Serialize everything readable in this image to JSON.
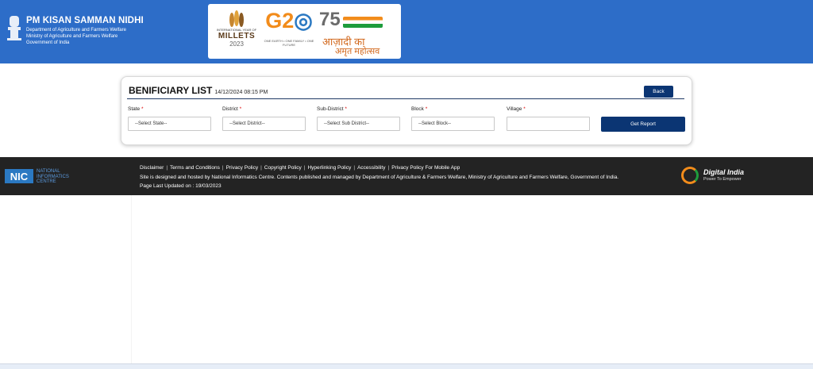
{
  "header": {
    "title": "PM KISAN SAMMAN NIDHI",
    "line1": "Department of Agriculture and Farmers Welfare",
    "line2": "Ministry of Agriculture and Farmers Welfare",
    "line3": "Government of India",
    "logos": {
      "millets_small": "INTERNATIONAL YEAR OF",
      "millets_big": "MILLETS",
      "millets_year": "2023",
      "g20_sub": "ONE EARTH • ONE FAMILY • ONE FUTURE",
      "azadi_num": "75",
      "azadi_word": "आज़ादी का",
      "azadi_word2": "अमृत महोत्सव"
    }
  },
  "card": {
    "title": "BENIFICIARY LIST",
    "timestamp": "14/12/2024 08:15 PM",
    "back_label": "Back",
    "get_report_label": "Get Report",
    "fields": [
      {
        "label": "State",
        "value": "--Select State--"
      },
      {
        "label": "District",
        "value": "--Select District--"
      },
      {
        "label": "Sub-District",
        "value": "--Select Sub District--"
      },
      {
        "label": "Block",
        "value": "--Select Block--"
      },
      {
        "label": "Village",
        "value": ""
      }
    ]
  },
  "footer": {
    "nic_short": "NIC",
    "nic_l1": "NATIONAL",
    "nic_l2": "INFORMATICS",
    "nic_l3": "CENTRE",
    "links": [
      "Disclaimer",
      "Terms and Conditions",
      "Privacy Policy",
      "Copyright Policy",
      "Hyperlinking Policy",
      "Accessibility",
      "Privacy Policy For Mobile App"
    ],
    "hosted_text": "Site is designed and hosted by National Informatics Centre. Contents published and managed by Department of Agriculture & Farmers Welfare, Ministry of Agriculture and Farmers Welfare, Government of India.",
    "updated_text": "Page Last Updated on : 19/03/2023",
    "di_title": "Digital India",
    "di_sub": "Power To Empower"
  },
  "colors": {
    "header_bg": "#2d6dc8",
    "button_bg": "#0b3573",
    "footer_bg": "#232323"
  }
}
